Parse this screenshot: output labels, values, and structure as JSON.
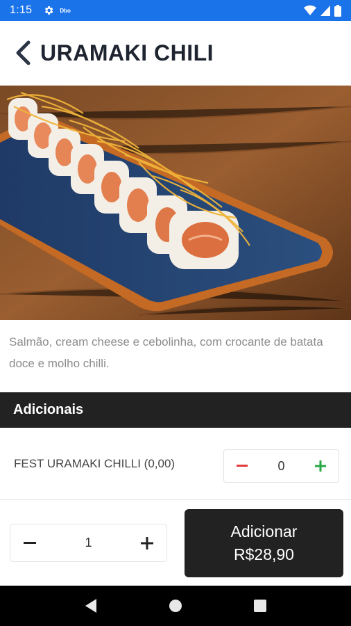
{
  "status_bar": {
    "time": "1:15",
    "icons": [
      "gear-icon",
      "notification-mini-icon",
      "wifi-icon",
      "signal-icon",
      "battery-icon"
    ],
    "mini_label": "Dbo"
  },
  "header": {
    "title": "URAMAKI CHILI",
    "back_icon": "chevron-left-icon"
  },
  "product": {
    "image_subject": "uramaki-sushi-rolls",
    "description": "Salmão, cream cheese e cebolinha, com crocante de batata doce e molho chilli."
  },
  "addons": {
    "section_title": "Adicionais",
    "items": [
      {
        "label": "FEST URAMAKI CHILLI (0,00)",
        "quantity": "0"
      }
    ]
  },
  "order": {
    "quantity": "1",
    "add_label": "Adicionar",
    "price": "R$28,90"
  },
  "nav": {
    "icons": [
      "back-triangle-icon",
      "home-circle-icon",
      "recents-square-icon"
    ]
  },
  "colors": {
    "status_bar": "#1a73e8",
    "dark": "#222222",
    "minus": "#e23b3b",
    "plus": "#27a843"
  }
}
